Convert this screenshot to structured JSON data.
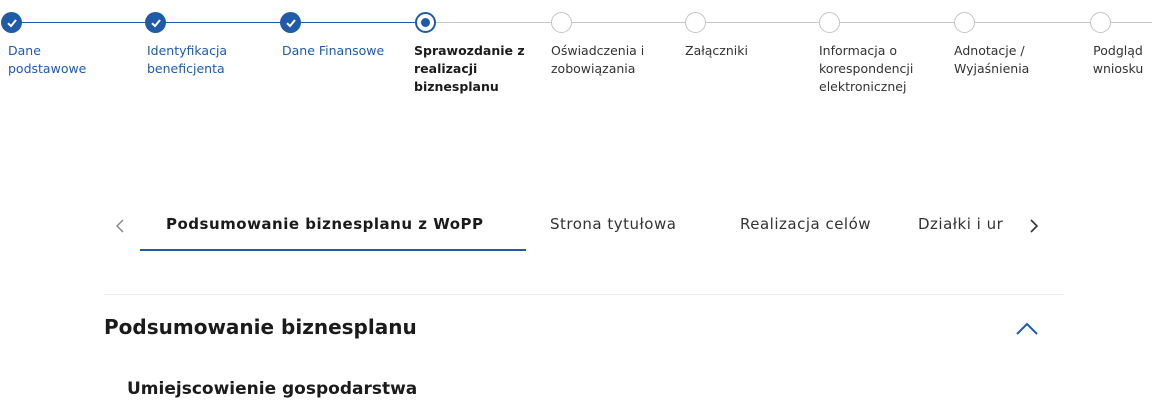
{
  "colors": {
    "accent": "#1f5ba8",
    "pending": "#c4c4c4"
  },
  "stepper": {
    "steps": [
      {
        "label": "Dane podstawowe",
        "state": "done",
        "icon": "check-icon"
      },
      {
        "label": "Identyfikacja beneficjenta",
        "state": "done",
        "icon": "check-icon"
      },
      {
        "label": "Dane Finansowe",
        "state": "done",
        "icon": "check-icon"
      },
      {
        "label": "Sprawozdanie z realizacji biznesplanu",
        "state": "current",
        "icon": "dot-icon"
      },
      {
        "label": "Oświadczenia i zobowiązania",
        "state": "todo",
        "icon": "empty-circle-icon"
      },
      {
        "label": "Załączniki",
        "state": "todo",
        "icon": "empty-circle-icon"
      },
      {
        "label": "Informacja o korespondencji elektronicznej",
        "state": "todo",
        "icon": "empty-circle-icon"
      },
      {
        "label": "Adnotacje / Wyjaśnienia",
        "state": "todo",
        "icon": "empty-circle-icon"
      },
      {
        "label": "Podgląd wniosku",
        "state": "todo",
        "icon": "empty-circle-icon"
      }
    ]
  },
  "tabs": {
    "items": [
      {
        "label": "Podsumowanie biznesplanu z WoPP",
        "active": true
      },
      {
        "label": "Strona tytułowa",
        "active": false
      },
      {
        "label": "Realizacja celów",
        "active": false
      },
      {
        "label": "Działki i ur",
        "active": false
      }
    ],
    "prev_icon": "chevron-left-icon",
    "next_icon": "chevron-right-icon"
  },
  "section": {
    "title": "Podsumowanie biznesplanu",
    "collapse_icon": "chevron-up-icon",
    "subsection_title": "Umiejscowienie gospodarstwa"
  }
}
